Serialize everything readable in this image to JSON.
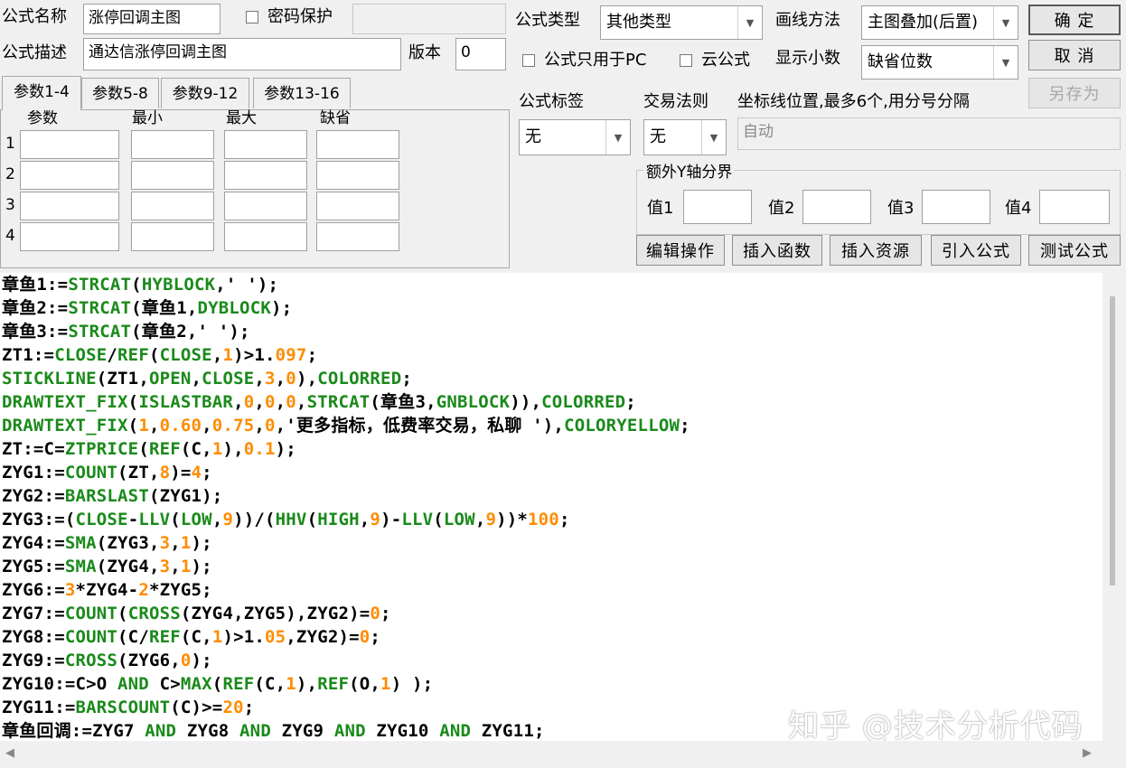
{
  "form": {
    "name_label": "公式名称",
    "name_value": "涨停回调主图",
    "password_label": "密码保护",
    "desc_label": "公式描述",
    "desc_value": "通达信涨停回调主图",
    "version_label": "版本",
    "version_value": "0",
    "type_label": "公式类型",
    "type_value": "其他类型",
    "draw_label": "画线方法",
    "draw_value": "主图叠加(后置)",
    "pc_only_label": "公式只用于PC",
    "cloud_label": "云公式",
    "decimals_label": "显示小数",
    "decimals_value": "缺省位数",
    "tag_label": "公式标签",
    "tag_value": "无",
    "rule_label": "交易法则",
    "rule_value": "无",
    "coord_label": "坐标线位置,最多6个,用分号分隔",
    "coord_value": "自动",
    "yaxis_group": "额外Y轴分界",
    "yaxis_labels": [
      "值1",
      "值2",
      "值3",
      "值4"
    ]
  },
  "buttons": {
    "ok": "确 定",
    "cancel": "取 消",
    "save_as": "另存为",
    "edit_ops": "编辑操作",
    "insert_func": "插入函数",
    "insert_res": "插入资源",
    "import_formula": "引入公式",
    "test_formula": "测试公式"
  },
  "tabs": [
    "参数1-4",
    "参数5-8",
    "参数9-12",
    "参数13-16"
  ],
  "params": {
    "headers": [
      "参数",
      "最小",
      "最大",
      "缺省"
    ],
    "rows": [
      "1",
      "2",
      "3",
      "4"
    ]
  },
  "colors": {
    "keyword": "#1a8a1a",
    "number": "#ff8c00",
    "text": "#000000"
  },
  "code_lines": [
    [
      [
        "t",
        "章鱼1:="
      ],
      [
        "k",
        "STRCAT"
      ],
      [
        "t",
        "("
      ],
      [
        "k",
        "HYBLOCK"
      ],
      [
        "t",
        ",' ');"
      ]
    ],
    [
      [
        "t",
        "章鱼2:="
      ],
      [
        "k",
        "STRCAT"
      ],
      [
        "t",
        "(章鱼1,"
      ],
      [
        "k",
        "DYBLOCK"
      ],
      [
        "t",
        ");"
      ]
    ],
    [
      [
        "t",
        "章鱼3:="
      ],
      [
        "k",
        "STRCAT"
      ],
      [
        "t",
        "(章鱼2,' ');"
      ]
    ],
    [
      [
        "t",
        "ZT1:="
      ],
      [
        "k",
        "CLOSE"
      ],
      [
        "t",
        "/"
      ],
      [
        "k",
        "REF"
      ],
      [
        "t",
        "("
      ],
      [
        "k",
        "CLOSE"
      ],
      [
        "t",
        ","
      ],
      [
        "n",
        "1"
      ],
      [
        "t",
        ")>"
      ],
      [
        "t",
        "1."
      ],
      [
        "n",
        "097"
      ],
      [
        "t",
        ";"
      ]
    ],
    [
      [
        "k",
        "STICKLINE"
      ],
      [
        "t",
        "(ZT1,"
      ],
      [
        "k",
        "OPEN"
      ],
      [
        "t",
        ","
      ],
      [
        "k",
        "CLOSE"
      ],
      [
        "t",
        ","
      ],
      [
        "n",
        "3"
      ],
      [
        "t",
        ","
      ],
      [
        "n",
        "0"
      ],
      [
        "t",
        "),"
      ],
      [
        "k",
        "COLORRED"
      ],
      [
        "t",
        ";"
      ]
    ],
    [
      [
        "k",
        "DRAWTEXT_FIX"
      ],
      [
        "t",
        "("
      ],
      [
        "k",
        "ISLASTBAR"
      ],
      [
        "t",
        ","
      ],
      [
        "n",
        "0"
      ],
      [
        "t",
        ","
      ],
      [
        "n",
        "0"
      ],
      [
        "t",
        ","
      ],
      [
        "n",
        "0"
      ],
      [
        "t",
        ","
      ],
      [
        "k",
        "STRCAT"
      ],
      [
        "t",
        "(章鱼3,"
      ],
      [
        "k",
        "GNBLOCK"
      ],
      [
        "t",
        ")),"
      ],
      [
        "k",
        "COLORRED"
      ],
      [
        "t",
        ";"
      ]
    ],
    [
      [
        "k",
        "DRAWTEXT_FIX"
      ],
      [
        "t",
        "("
      ],
      [
        "n",
        "1"
      ],
      [
        "t",
        ","
      ],
      [
        "n",
        "0.60"
      ],
      [
        "t",
        ","
      ],
      [
        "n",
        "0.75"
      ],
      [
        "t",
        ","
      ],
      [
        "n",
        "0"
      ],
      [
        "t",
        ",'更多指标，低费率交易，私聊 '),"
      ],
      [
        "k",
        "COLORYELLOW"
      ],
      [
        "t",
        ";"
      ]
    ],
    [
      [
        "t",
        "ZT:=C="
      ],
      [
        "k",
        "ZTPRICE"
      ],
      [
        "t",
        "("
      ],
      [
        "k",
        "REF"
      ],
      [
        "t",
        "(C,"
      ],
      [
        "n",
        "1"
      ],
      [
        "t",
        "),"
      ],
      [
        "n",
        "0.1"
      ],
      [
        "t",
        ");"
      ]
    ],
    [
      [
        "t",
        "ZYG1:="
      ],
      [
        "k",
        "COUNT"
      ],
      [
        "t",
        "(ZT,"
      ],
      [
        "n",
        "8"
      ],
      [
        "t",
        ")="
      ],
      [
        "n",
        "4"
      ],
      [
        "t",
        ";"
      ]
    ],
    [
      [
        "t",
        "ZYG2:="
      ],
      [
        "k",
        "BARSLAST"
      ],
      [
        "t",
        "(ZYG1);"
      ]
    ],
    [
      [
        "t",
        "ZYG3:=("
      ],
      [
        "k",
        "CLOSE"
      ],
      [
        "t",
        "-"
      ],
      [
        "k",
        "LLV"
      ],
      [
        "t",
        "("
      ],
      [
        "k",
        "LOW"
      ],
      [
        "t",
        ","
      ],
      [
        "n",
        "9"
      ],
      [
        "t",
        "))/("
      ],
      [
        "k",
        "HHV"
      ],
      [
        "t",
        "("
      ],
      [
        "k",
        "HIGH"
      ],
      [
        "t",
        ","
      ],
      [
        "n",
        "9"
      ],
      [
        "t",
        ")-"
      ],
      [
        "k",
        "LLV"
      ],
      [
        "t",
        "("
      ],
      [
        "k",
        "LOW"
      ],
      [
        "t",
        ","
      ],
      [
        "n",
        "9"
      ],
      [
        "t",
        "))*"
      ],
      [
        "n",
        "100"
      ],
      [
        "t",
        ";"
      ]
    ],
    [
      [
        "t",
        "ZYG4:="
      ],
      [
        "k",
        "SMA"
      ],
      [
        "t",
        "(ZYG3,"
      ],
      [
        "n",
        "3"
      ],
      [
        "t",
        ","
      ],
      [
        "n",
        "1"
      ],
      [
        "t",
        ");"
      ]
    ],
    [
      [
        "t",
        "ZYG5:="
      ],
      [
        "k",
        "SMA"
      ],
      [
        "t",
        "(ZYG4,"
      ],
      [
        "n",
        "3"
      ],
      [
        "t",
        ","
      ],
      [
        "n",
        "1"
      ],
      [
        "t",
        ");"
      ]
    ],
    [
      [
        "t",
        "ZYG6:="
      ],
      [
        "n",
        "3"
      ],
      [
        "t",
        "*ZYG4-"
      ],
      [
        "n",
        "2"
      ],
      [
        "t",
        "*ZYG5;"
      ]
    ],
    [
      [
        "t",
        "ZYG7:="
      ],
      [
        "k",
        "COUNT"
      ],
      [
        "t",
        "("
      ],
      [
        "k",
        "CROSS"
      ],
      [
        "t",
        "(ZYG4,ZYG5),ZYG2)="
      ],
      [
        "n",
        "0"
      ],
      [
        "t",
        ";"
      ]
    ],
    [
      [
        "t",
        "ZYG8:="
      ],
      [
        "k",
        "COUNT"
      ],
      [
        "t",
        "(C/"
      ],
      [
        "k",
        "REF"
      ],
      [
        "t",
        "(C,"
      ],
      [
        "n",
        "1"
      ],
      [
        "t",
        ")>1."
      ],
      [
        "n",
        "05"
      ],
      [
        "t",
        ",ZYG2)="
      ],
      [
        "n",
        "0"
      ],
      [
        "t",
        ";"
      ]
    ],
    [
      [
        "t",
        "ZYG9:="
      ],
      [
        "k",
        "CROSS"
      ],
      [
        "t",
        "(ZYG6,"
      ],
      [
        "n",
        "0"
      ],
      [
        "t",
        ");"
      ]
    ],
    [
      [
        "t",
        "ZYG10:=C>O "
      ],
      [
        "k",
        "AND"
      ],
      [
        "t",
        " C>"
      ],
      [
        "k",
        "MAX"
      ],
      [
        "t",
        "("
      ],
      [
        "k",
        "REF"
      ],
      [
        "t",
        "(C,"
      ],
      [
        "n",
        "1"
      ],
      [
        "t",
        "),"
      ],
      [
        "k",
        "REF"
      ],
      [
        "t",
        "(O,"
      ],
      [
        "n",
        "1"
      ],
      [
        "t",
        ") );"
      ]
    ],
    [
      [
        "t",
        "ZYG11:="
      ],
      [
        "k",
        "BARSCOUNT"
      ],
      [
        "t",
        "(C)>="
      ],
      [
        "n",
        "20"
      ],
      [
        "t",
        ";"
      ]
    ],
    [
      [
        "t",
        "章鱼回调:=ZYG7 "
      ],
      [
        "k",
        "AND"
      ],
      [
        "t",
        " ZYG8 "
      ],
      [
        "k",
        "AND"
      ],
      [
        "t",
        " ZYG9 "
      ],
      [
        "k",
        "AND"
      ],
      [
        "t",
        " ZYG10 "
      ],
      [
        "k",
        "AND"
      ],
      [
        "t",
        " ZYG11;"
      ]
    ]
  ],
  "watermark": "知乎 @技术分析代码"
}
